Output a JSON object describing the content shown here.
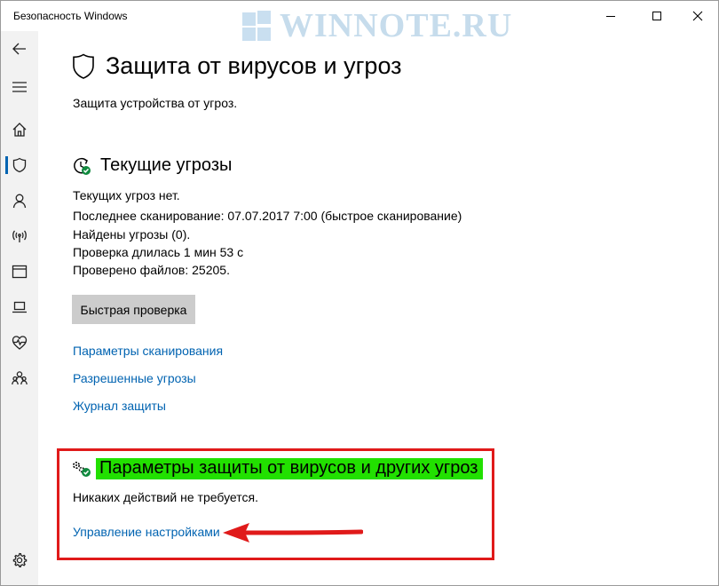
{
  "window": {
    "title": "Безопасность Windows",
    "watermark": "WINNOTE.RU",
    "controls": [
      "minimize",
      "maximize",
      "close"
    ]
  },
  "sidebar": {
    "items": [
      {
        "name": "back",
        "icon": "back-arrow-icon"
      },
      {
        "name": "menu",
        "icon": "hamburger-menu-icon"
      },
      {
        "name": "home",
        "icon": "home-icon"
      },
      {
        "name": "virus-protection",
        "icon": "shield-icon",
        "active": true
      },
      {
        "name": "account-protection",
        "icon": "person-icon"
      },
      {
        "name": "firewall",
        "icon": "network-antenna-icon"
      },
      {
        "name": "app-browser-control",
        "icon": "browser-window-icon"
      },
      {
        "name": "device-security",
        "icon": "laptop-icon"
      },
      {
        "name": "device-performance",
        "icon": "heart-health-icon"
      },
      {
        "name": "family-options",
        "icon": "family-icon"
      },
      {
        "name": "settings",
        "icon": "gear-icon"
      }
    ]
  },
  "page": {
    "title": "Защита от вирусов и угроз",
    "subtitle": "Защита устройства от угроз."
  },
  "current_threats": {
    "title": "Текущие угрозы",
    "lines": [
      "Текущих угроз нет.",
      "Последнее сканирование: 07.07.2017 7:00 (быстрое сканирование)",
      "Найдены угрозы (0).",
      "Проверка длилась 1 мин 53 с",
      "Проверено файлов: 25205."
    ],
    "quick_scan_label": "Быстрая проверка",
    "links": [
      "Параметры сканирования",
      "Разрешенные угрозы",
      "Журнал защиты"
    ]
  },
  "protection_settings": {
    "title": "Параметры защиты от вирусов и других угроз",
    "status": "Никаких действий не требуется.",
    "manage_link": "Управление настройками",
    "highlight_color": "#22e000",
    "box_color": "#e01a1a"
  },
  "colors": {
    "link": "#0063b1",
    "sidebar_bg": "#f2f2f2",
    "status_ok": "#10893e"
  }
}
